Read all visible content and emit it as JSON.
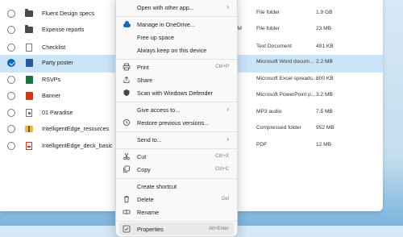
{
  "files": [
    {
      "name": "Fluent Design specs",
      "date": "",
      "type": "File folder",
      "size": "1.9 GB",
      "icon": "folder-dark-icon"
    },
    {
      "name": "Expense reports",
      "date": "PM",
      "type": "File folder",
      "size": "23 MB",
      "icon": "folder-icon"
    },
    {
      "name": "Checklist",
      "date": "",
      "type": "Text Document",
      "size": "491 KB",
      "icon": "text-document-icon"
    },
    {
      "name": "Party poster",
      "date": "",
      "type": "Microsoft Word docum...",
      "size": "2.2 MB",
      "icon": "word-document-icon"
    },
    {
      "name": "RSVPs",
      "date": "",
      "type": "Microsoft Excel spreads...",
      "size": "800 KB",
      "icon": "excel-spreadsheet-icon"
    },
    {
      "name": "Banner",
      "date": "",
      "type": "Microsoft PowerPoint p...",
      "size": "3.2 MB",
      "icon": "powerpoint-icon"
    },
    {
      "name": "01 Paradise",
      "date": "",
      "type": "MP3 audio",
      "size": "7.5 MB",
      "icon": "audio-file-icon"
    },
    {
      "name": "IntelligentEdge_resources",
      "date": "",
      "type": "Compressed folder",
      "size": "952 MB",
      "icon": "zip-folder-icon"
    },
    {
      "name": "IntelligentEdge_deck_basic",
      "date": "",
      "type": "PDF",
      "size": "12 MB",
      "icon": "pdf-file-icon"
    }
  ],
  "selected_index": 3,
  "menu": {
    "open_with": "Open with other app...",
    "manage_onedrive": "Manage in OneDrive...",
    "free_up_space": "Free up space",
    "always_keep": "Always keep on this device",
    "print": "Print",
    "print_shortcut": "Ctrl+P",
    "share": "Share",
    "scan": "Scan with Windows Defender",
    "give_access": "Give access to...",
    "restore_versions": "Restore previous versions...",
    "send_to": "Send to...",
    "cut": "Cut",
    "cut_shortcut": "Ctrl+X",
    "copy": "Copy",
    "copy_shortcut": "Ctrl+C",
    "create_shortcut": "Create shortcut",
    "delete": "Delete",
    "delete_shortcut": "Del",
    "rename": "Rename",
    "properties": "Properties",
    "properties_shortcut": "Alt+Enter"
  },
  "colors": {
    "selection": "#cce4f7",
    "accent": "#0067c0",
    "onedrive": "#0f6cbd"
  }
}
